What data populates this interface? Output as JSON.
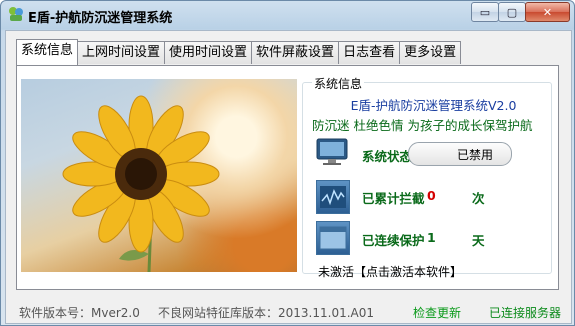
{
  "window": {
    "title": "E盾-护航防沉迷管理系统",
    "buttons": {
      "minimize": "▭",
      "maximize": "▢",
      "close": "✕"
    }
  },
  "tabs": [
    {
      "label": "系统信息",
      "active": true
    },
    {
      "label": "上网时间设置",
      "active": false
    },
    {
      "label": "使用时间设置",
      "active": false
    },
    {
      "label": "软件屏蔽设置",
      "active": false
    },
    {
      "label": "日志查看",
      "active": false
    },
    {
      "label": "更多设置",
      "active": false
    }
  ],
  "system_info": {
    "group_title": "系统信息",
    "product_name": "E盾-护航防沉迷管理系统V2.0",
    "slogan": "防沉迷 杜绝色情 为孩子的成长保驾护航",
    "status_label": "系统状态",
    "status_value": "已禁用",
    "blocked_label": "已累计拦截",
    "blocked_count": "0",
    "blocked_unit": "次",
    "protected_label": "已连续保护",
    "protected_days": "1",
    "protected_unit": "天",
    "activation_text": "未激活【点击激活本软件】"
  },
  "footer": {
    "version_text": "软件版本号：Mver2.0",
    "database_text": "不良网站特征库版本：2013.11.01.A01",
    "check_update": "检查更新",
    "connection_status": "已连接服务器"
  },
  "colors": {
    "accent_green": "#0a6a1a",
    "brand_blue": "#1a3ea0",
    "counter_red": "#d40000"
  }
}
